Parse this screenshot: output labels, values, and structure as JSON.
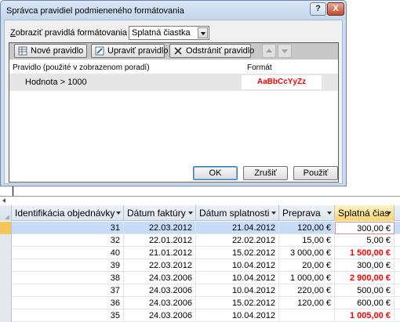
{
  "dialog": {
    "title": "Správca pravidiel podmieneného formátovania",
    "help_glyph": "?",
    "close_glyph": "X",
    "show_label_prefix": "Z",
    "show_label_rest": "obraziť pravidlá formátovania pre:",
    "show_select_value": "Splatná čiastka",
    "toolbar": {
      "new_rule": "Nové pravidlo",
      "edit_rule": "Upraviť pravidlo",
      "delete_rule": "Odstrániť pravidlo"
    },
    "list": {
      "col_rule": "Pravidlo (použité v zobrazenom poradí)",
      "col_format": "Formát",
      "rows": [
        {
          "rule": "Hodnota > 1000",
          "preview": "AaBbCcYyZz"
        }
      ]
    },
    "buttons": {
      "ok": "OK",
      "cancel": "Zrušiť",
      "apply": "Použiť"
    }
  },
  "table": {
    "headers": {
      "id": "Identifikácia objednávky",
      "invoice_date": "Dátum faktúry",
      "due_date": "Dátum splatnosti",
      "shipping": "Preprava",
      "amount": "Splatná čias"
    },
    "rows": [
      {
        "id": "31",
        "invoice_date": "22.03.2012",
        "due_date": "21.04.2012",
        "shipping": "120,00 €",
        "amount": "300,00 €",
        "highlight": false
      },
      {
        "id": "32",
        "invoice_date": "22.01.2012",
        "due_date": "22.02.2012",
        "shipping": "15,00 €",
        "amount": "5,00 €",
        "highlight": false
      },
      {
        "id": "40",
        "invoice_date": "21.01.2012",
        "due_date": "15.02.2012",
        "shipping": "3 000,00 €",
        "amount": "1 500,00 €",
        "highlight": true
      },
      {
        "id": "39",
        "invoice_date": "22.03.2012",
        "due_date": "10.04.2012",
        "shipping": "20,00 €",
        "amount": "300,00 €",
        "highlight": false
      },
      {
        "id": "38",
        "invoice_date": "24.03.2006",
        "due_date": "10.04.2012",
        "shipping": "1 000,00 €",
        "amount": "2 900,00 €",
        "highlight": true
      },
      {
        "id": "37",
        "invoice_date": "24.03.2006",
        "due_date": "10.04.2012",
        "shipping": "220,00 €",
        "amount": "500,00 €",
        "highlight": false
      },
      {
        "id": "36",
        "invoice_date": "24.03.2006",
        "due_date": "15.02.2012",
        "shipping": "120,00 €",
        "amount": "600,00 €",
        "highlight": false
      },
      {
        "id": "35",
        "invoice_date": "24.03.2006",
        "due_date": "10.04.2012",
        "shipping": "",
        "amount": "1 005,00 €",
        "highlight": true
      }
    ]
  }
}
